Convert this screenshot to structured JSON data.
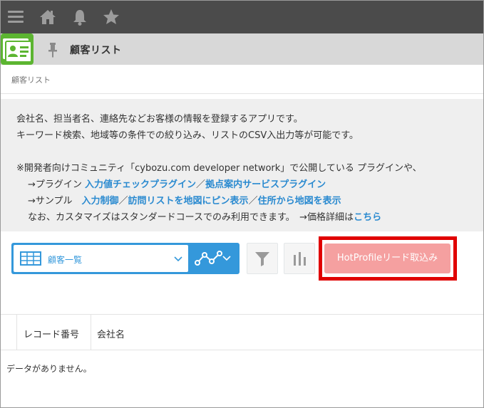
{
  "topbar": {
    "icons": [
      "menu-icon",
      "home-icon",
      "bell-icon",
      "star-icon"
    ]
  },
  "app": {
    "title": "顧客リスト",
    "breadcrumb": "顧客リスト"
  },
  "description": {
    "line1": "会社名、担当者名、連絡先などお客様の情報を登録するアプリです。",
    "line2": "キーワード検索、地域等の条件での絞り込み、リストのCSV入出力等が可能です。",
    "line3": "※開発者向けコミュニティ「cybozu.com developer network」で公開している プラグインや、",
    "plugin_prefix": "→プラグイン ",
    "plugin_link1": "入力値チェックプラグイン",
    "plugin_sep": "／",
    "plugin_link2": "拠点案内サービスプラグイン",
    "sample_prefix": "→サンプル　",
    "sample_link1": "入力制御",
    "sample_sep1": "／",
    "sample_link2": "訪問リストを地図にピン表示",
    "sample_sep2": "／",
    "sample_link3": "住所から地図を表示",
    "note_text": "なお、カスタマイズはスタンダードコースでのみ利用できます。　→価格詳細は",
    "note_link": "こちら"
  },
  "toolbar": {
    "view_label": "顧客一覧",
    "hotprofile_button": "HotProfileリード取込み"
  },
  "table": {
    "headers": [
      "レコード番号",
      "会社名"
    ],
    "empty_message": "データがありません。"
  },
  "colors": {
    "topbar": "#4b4b4b",
    "accent": "#3498db",
    "link": "#2a8ad0",
    "highlight": "#e00000",
    "hotprofile_button": "#f5a0a0"
  }
}
